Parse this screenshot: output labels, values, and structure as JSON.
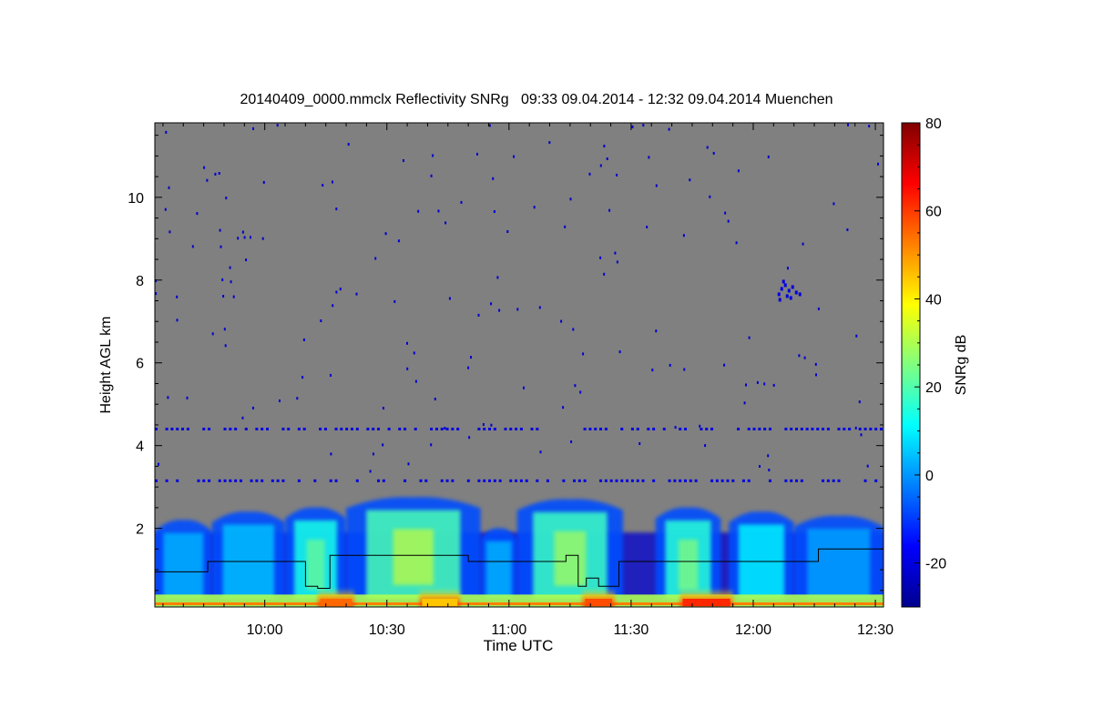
{
  "chart_data": {
    "type": "heatmap",
    "title": "20140409_0000.mmclx Reflectivity SNRg   09:33 09.04.2014 - 12:32 09.04.2014 Muenchen",
    "xlabel": "Time UTC",
    "ylabel": "Height AGL km",
    "x_range": [
      "09:33",
      "12:32"
    ],
    "x_ticks": [
      "10:00",
      "10:30",
      "11:00",
      "11:30",
      "12:00",
      "12:30"
    ],
    "y_range": [
      0.1,
      11.8
    ],
    "y_ticks": [
      2,
      4,
      6,
      8,
      10
    ],
    "background_color": "#808080",
    "colorbar": {
      "label": "SNRg dB",
      "range": [
        -30,
        80
      ],
      "ticks": [
        -20,
        0,
        20,
        40,
        60,
        80
      ],
      "colormap": "jet"
    },
    "cloud_echo_regions": [
      {
        "start": "09:33",
        "end": "09:47",
        "top_km": 2.2,
        "peak_snr_db": 5
      },
      {
        "start": "09:47",
        "end": "10:05",
        "top_km": 2.4,
        "peak_snr_db": 8
      },
      {
        "start": "10:05",
        "end": "10:20",
        "top_km": 2.5,
        "peak_snr_db": 25
      },
      {
        "start": "10:20",
        "end": "10:53",
        "top_km": 2.75,
        "peak_snr_db": 35
      },
      {
        "start": "10:53",
        "end": "11:02",
        "top_km": 2.0,
        "peak_snr_db": 5
      },
      {
        "start": "11:02",
        "end": "11:28",
        "top_km": 2.7,
        "peak_snr_db": 32
      },
      {
        "start": "11:36",
        "end": "11:52",
        "top_km": 2.5,
        "peak_snr_db": 28
      },
      {
        "start": "11:54",
        "end": "12:10",
        "top_km": 2.4,
        "peak_snr_db": 18
      },
      {
        "start": "12:10",
        "end": "12:32",
        "top_km": 2.3,
        "peak_snr_db": 2
      }
    ],
    "near_surface_max_regions": [
      {
        "start": "10:13",
        "end": "10:22",
        "peak_snr_db": 55
      },
      {
        "start": "10:38",
        "end": "10:48",
        "peak_snr_db": 45
      },
      {
        "start": "11:18",
        "end": "11:26",
        "peak_snr_db": 58
      },
      {
        "start": "11:42",
        "end": "11:55",
        "peak_snr_db": 62
      }
    ],
    "weak_echo_layers_km": [
      4.4,
      3.15
    ],
    "isolated_echo_patch": {
      "time": "12:08",
      "height_km": 7.7,
      "snr_db": -20
    },
    "overlay_line": [
      {
        "time": "09:33",
        "height_km": 0.95
      },
      {
        "time": "09:46",
        "height_km": 0.95
      },
      {
        "time": "09:46",
        "height_km": 1.2
      },
      {
        "time": "10:10",
        "height_km": 1.2
      },
      {
        "time": "10:10",
        "height_km": 0.6
      },
      {
        "time": "10:13",
        "height_km": 0.6
      },
      {
        "time": "10:13",
        "height_km": 0.55
      },
      {
        "time": "10:16",
        "height_km": 0.55
      },
      {
        "time": "10:16",
        "height_km": 1.35
      },
      {
        "time": "10:50",
        "height_km": 1.35
      },
      {
        "time": "10:50",
        "height_km": 1.2
      },
      {
        "time": "11:14",
        "height_km": 1.2
      },
      {
        "time": "11:14",
        "height_km": 1.35
      },
      {
        "time": "11:17",
        "height_km": 1.35
      },
      {
        "time": "11:17",
        "height_km": 0.6
      },
      {
        "time": "11:19",
        "height_km": 0.6
      },
      {
        "time": "11:19",
        "height_km": 0.8
      },
      {
        "time": "11:22",
        "height_km": 0.8
      },
      {
        "time": "11:22",
        "height_km": 0.6
      },
      {
        "time": "11:27",
        "height_km": 0.6
      },
      {
        "time": "11:27",
        "height_km": 1.2
      },
      {
        "time": "12:16",
        "height_km": 1.2
      },
      {
        "time": "12:16",
        "height_km": 1.5
      },
      {
        "time": "12:32",
        "height_km": 1.5
      }
    ]
  }
}
